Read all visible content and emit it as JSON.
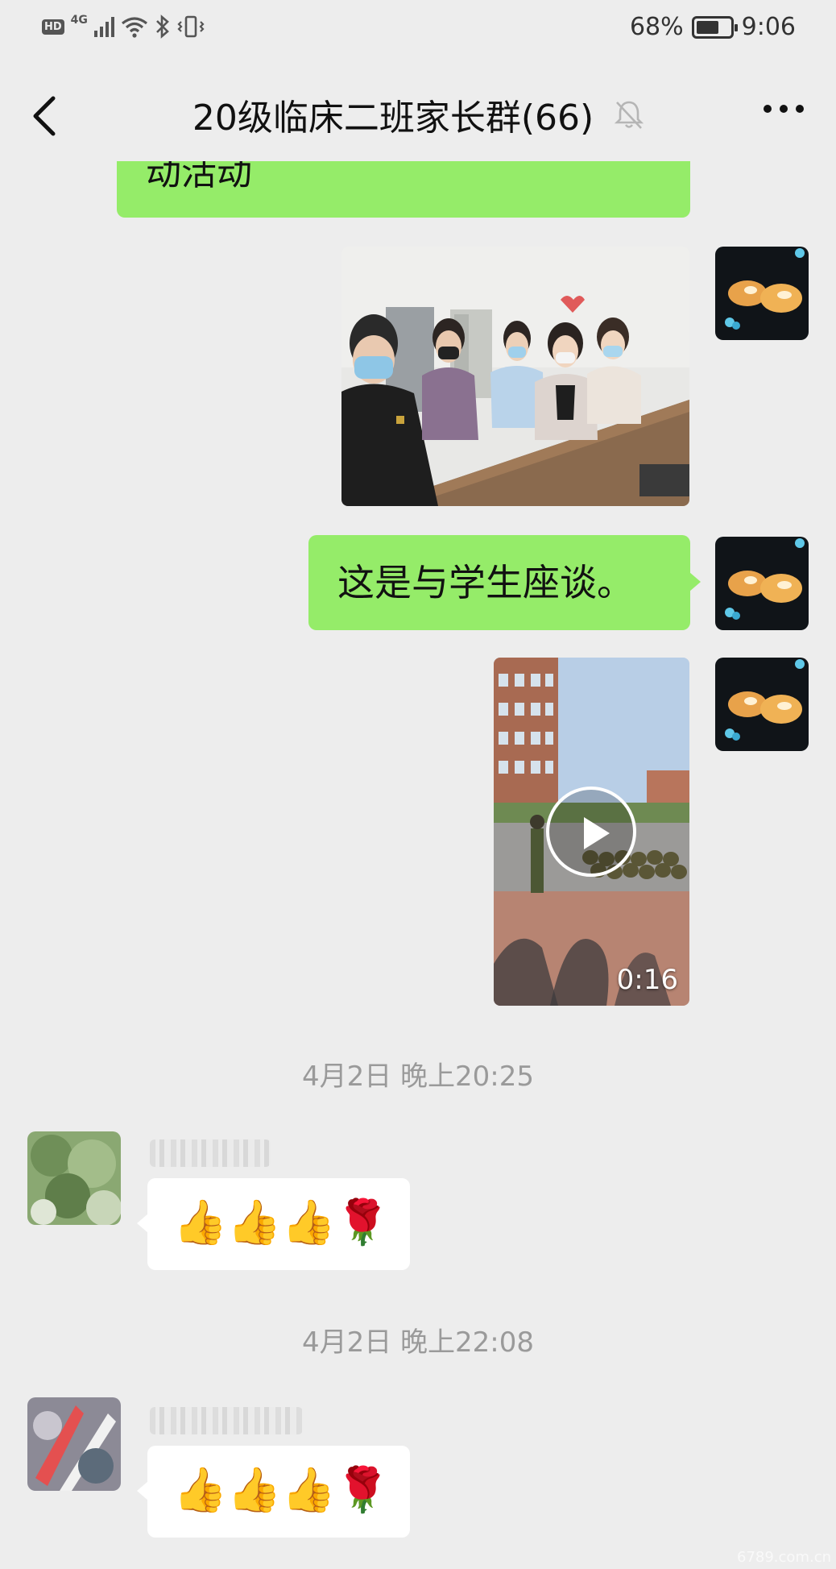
{
  "status_bar": {
    "hd": "HD",
    "network": "4G",
    "battery_percent": "68%",
    "battery_level": 0.68,
    "time": "9:06"
  },
  "header": {
    "title": "20级临床二班家长群(66)"
  },
  "messages": {
    "partial_text": "动活动",
    "text_1": "这是与学生座谈。",
    "video_duration": "0:16",
    "timestamp_1": "4月2日 晚上20:25",
    "timestamp_2": "4月2日 晚上22:08",
    "emoji_1": "👍👍👍🌹",
    "emoji_2": "👍👍👍🌹"
  },
  "watermark": "6789.com.cn",
  "colors": {
    "background": "#ededed",
    "sent_bubble": "#95ec69",
    "received_bubble": "#ffffff"
  }
}
